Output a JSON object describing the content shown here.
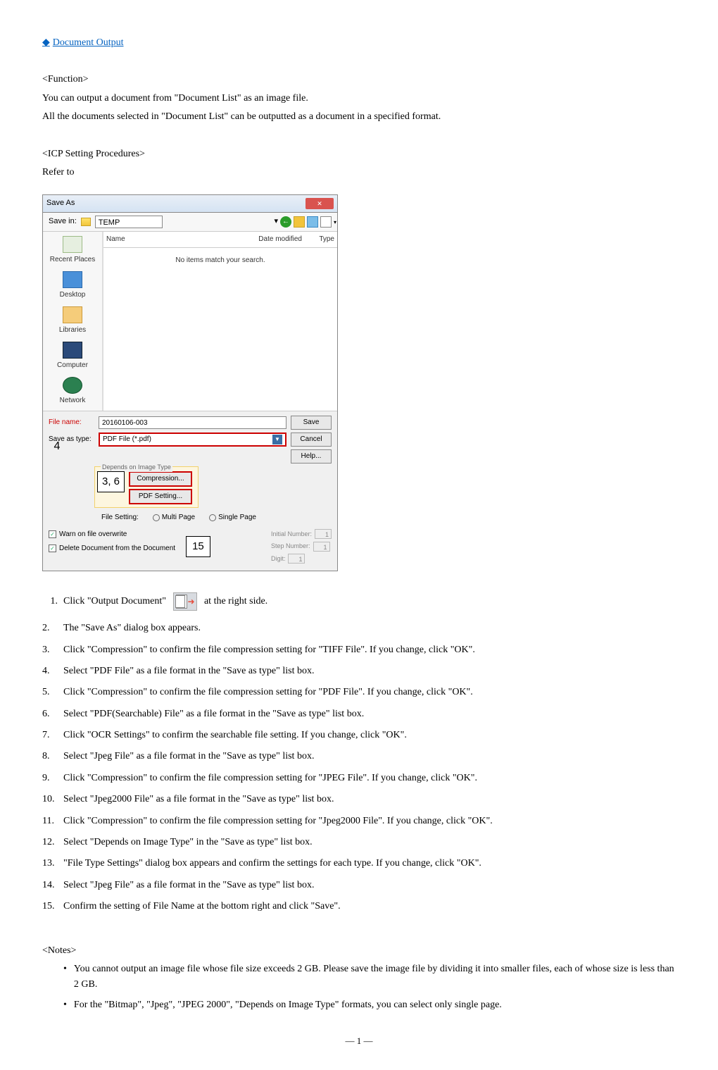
{
  "heading": "Document Output",
  "function": {
    "label": "<Function>",
    "line1": "You can output a document from \"Document List\" as an image file.",
    "line2": "All the documents selected in \"Document List\" can be outputted as a document in a specified format."
  },
  "procedures": {
    "label": "<ICP Setting Procedures>",
    "refer": "Refer to"
  },
  "dialog": {
    "title": "Save As",
    "save_in_label": "Save in:",
    "save_in_value": "TEMP",
    "cols": {
      "name": "Name",
      "date": "Date modified",
      "type": "Type"
    },
    "no_items": "No items match your search.",
    "places": {
      "recent": "Recent Places",
      "desktop": "Desktop",
      "libraries": "Libraries",
      "computer": "Computer",
      "network": "Network"
    },
    "file_name_label": "File name:",
    "file_name_value": "20160106-003",
    "save_as_type_label": "Save as type:",
    "save_as_type_value": "PDF File (*.pdf)",
    "buttons": {
      "save": "Save",
      "cancel": "Cancel",
      "help": "Help..."
    },
    "depends_title": "Depends on Image Type",
    "compression_btn": "Compression...",
    "pdf_setting_btn": "PDF Setting...",
    "file_setting_label": "File Setting:",
    "radio_multi": "Multi Page",
    "radio_single": "Single Page",
    "chk_warn": "Warn on file overwrite",
    "chk_delete": "Delete Document from the Document",
    "initial_number_label": "Initial Number:",
    "initial_number_value": "1",
    "step_number_label": "Step Number:",
    "step_number_value": "1",
    "digit_label": "Digit:",
    "digit_value": "1"
  },
  "callouts": {
    "c4": "4",
    "c36": "3, 6",
    "c15": "15"
  },
  "steps": [
    {
      "n": "1.",
      "pre": "Click \"Output Document\"",
      "post": "at the right side."
    },
    {
      "n": "2.",
      "t": "The \"Save As\" dialog box appears."
    },
    {
      "n": "3.",
      "t": "Click \"Compression\" to confirm the file compression setting for \"TIFF File\". If you change, click \"OK\"."
    },
    {
      "n": "4.",
      "t": "Select \"PDF File\" as a file format in the \"Save as type\" list box."
    },
    {
      "n": "5.",
      "t": "Click \"Compression\" to confirm the file compression setting for \"PDF File\". If you change, click \"OK\"."
    },
    {
      "n": "6.",
      "t": "Select \"PDF(Searchable) File\" as a file format in the \"Save as type\" list box."
    },
    {
      "n": "7.",
      "t": "Click \"OCR Settings\" to confirm the searchable file setting. If you change, click \"OK\"."
    },
    {
      "n": "8.",
      "t": "Select \"Jpeg File\" as a file format in the \"Save as type\" list box."
    },
    {
      "n": "9.",
      "t": "Click \"Compression\" to confirm the file compression setting for \"JPEG File\". If you change, click \"OK\"."
    },
    {
      "n": "10.",
      "t": "Select \"Jpeg2000 File\" as a file format in the \"Save as type\" list box."
    },
    {
      "n": "11.",
      "t": "Click \"Compression\" to confirm the file compression setting for \"Jpeg2000 File\". If you change, click \"OK\"."
    },
    {
      "n": "12.",
      "t": "Select \"Depends on Image Type\" in the \"Save as type\" list box."
    },
    {
      "n": "13.",
      "t": "\"File Type Settings\" dialog box appears and confirm the settings for each type. If you change, click \"OK\"."
    },
    {
      "n": "14.",
      "t": "Select \"Jpeg File\" as a file format in the \"Save as type\" list box."
    },
    {
      "n": "15.",
      "t": "Confirm the setting of File Name at the bottom right and click \"Save\"."
    }
  ],
  "notes": {
    "label": "<Notes>",
    "items": [
      "You cannot output an image file whose file size exceeds 2 GB. Please save the image file by dividing it into smaller files, each of whose size is less than 2 GB.",
      "For the \"Bitmap\", \"Jpeg\", \"JPEG 2000\", \"Depends on Image Type\" formats, you can select only single page."
    ]
  },
  "footer": "― 1 ―"
}
